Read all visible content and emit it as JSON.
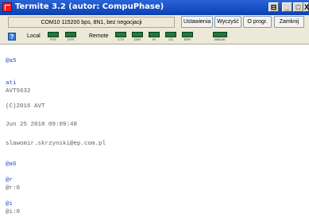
{
  "window": {
    "title": "Termite 3.2 (autor: CompuPhase)"
  },
  "titlebar_buttons": {
    "pin_glyph": "⊟",
    "min_glyph": "_",
    "max_glyph": "□",
    "close_glyph": "X"
  },
  "toolbar": {
    "port_info": "COM10 115200 bps, 8N1, bez negocjacji",
    "buttons": [
      "Ustawienia",
      "Wyczyść",
      "O progr.",
      "Zamknij"
    ]
  },
  "status": {
    "help_glyph": "?",
    "local_label": "Local",
    "remote_label": "Remote",
    "local_leds": [
      "RTS",
      "DTR"
    ],
    "remote_leds": [
      "CTS",
      "DSR",
      "RI",
      "CD",
      "ERR"
    ],
    "break_label": "BREAK"
  },
  "terminal": {
    "lines": [
      {
        "text": "@a5",
        "type": "tx"
      },
      {
        "text": "ati",
        "type": "tx"
      },
      {
        "text": "AVT5632",
        "type": "rx"
      },
      {
        "text": "(C)2016 AVT",
        "type": "rx"
      },
      {
        "text": "Jun 25 2018 09:09:48",
        "type": "rx"
      },
      {
        "text": "slawomir.skrzynski@ep.com.pl",
        "type": "rx"
      },
      {
        "text": "@a6",
        "type": "tx"
      },
      {
        "text": "@r",
        "type": "tx"
      },
      {
        "text": "@r:0",
        "type": "rx"
      },
      {
        "text": "@i",
        "type": "tx"
      },
      {
        "text": "@i:0",
        "type": "rx"
      }
    ]
  },
  "colors": {
    "tx": "#2a4ad0",
    "rx": "#5f5f5f",
    "led_on": "#1e7a3a"
  }
}
